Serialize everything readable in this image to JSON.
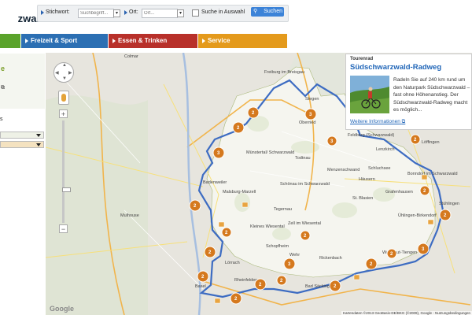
{
  "site": {
    "logo_text": "zwald"
  },
  "search": {
    "keyword_label": "Stichwort:",
    "keyword_placeholder": "Suchbegriff...",
    "place_label": "Ort:",
    "place_placeholder": "Ort...",
    "within_label": "Suche in Auswahl",
    "button_label": "Suchen"
  },
  "nav": {
    "items": [
      {
        "label": "",
        "color": "#5aa32b"
      },
      {
        "label": "Freizeit & Sport",
        "color": "#2c6fb3"
      },
      {
        "label": "Essen & Trinken",
        "color": "#b8302a"
      },
      {
        "label": "Service",
        "color": "#e49a1c"
      }
    ]
  },
  "sidebar": {
    "green_title": "e",
    "ext_icon": "external-link-icon",
    "label_s": "s"
  },
  "map": {
    "towns": [
      "Colmar",
      "Freiburg im Breisgau",
      "Stegen",
      "Oberried",
      "Münstertal/ Schwarzwald",
      "Todtnau",
      "Feldberg (Schwarzwald)",
      "Lenzkirch",
      "Löffingen",
      "Menzenschwand",
      "Schluchsee",
      "Schönau im Schwarzwald",
      "Häusern",
      "Grafenhausen",
      "St. Blasien",
      "Mulhouse",
      "Kleines Wiesental",
      "Schopfheim",
      "Wehr",
      "Rickenbach",
      "Lörrach",
      "Basel",
      "Waldshut-Tiengen",
      "Ühlingen-Birkendorf",
      "Bonndorf im Schwarzwald",
      "Stühlingen",
      "Badenweiler",
      "Malsburg-Marzell",
      "Tegernau",
      "Zell im Wiesental",
      "Bad Säckingen",
      "Rheinfelden"
    ],
    "clusters": [
      "2",
      "2",
      "3",
      "3",
      "2",
      "2",
      "2",
      "2",
      "2",
      "3",
      "2",
      "2",
      "3",
      "2",
      "3",
      "2",
      "2",
      "2",
      "2",
      "2",
      "2",
      "2"
    ],
    "popup": {
      "kicker": "Tourenrad",
      "title": "Südschwarzwald-Radweg",
      "description": "Radeln Sie auf 240 km rund um den Naturpark Südschwarzwald – fast ohne Höhenanstieg. Der Südschwarzwald-Radweg macht es möglich...",
      "more_link": "Weitere Informationen"
    },
    "copyright": "Kartendaten ©2013 GeoBasis-DE/BKG (©2009), Google - Nutzungsbedingungen",
    "google_logo": "Google"
  },
  "colors": {
    "route": "#3d6cc2",
    "cluster": "#d5791e",
    "park": "#f5f5ef",
    "accent": "#3c83d8"
  }
}
